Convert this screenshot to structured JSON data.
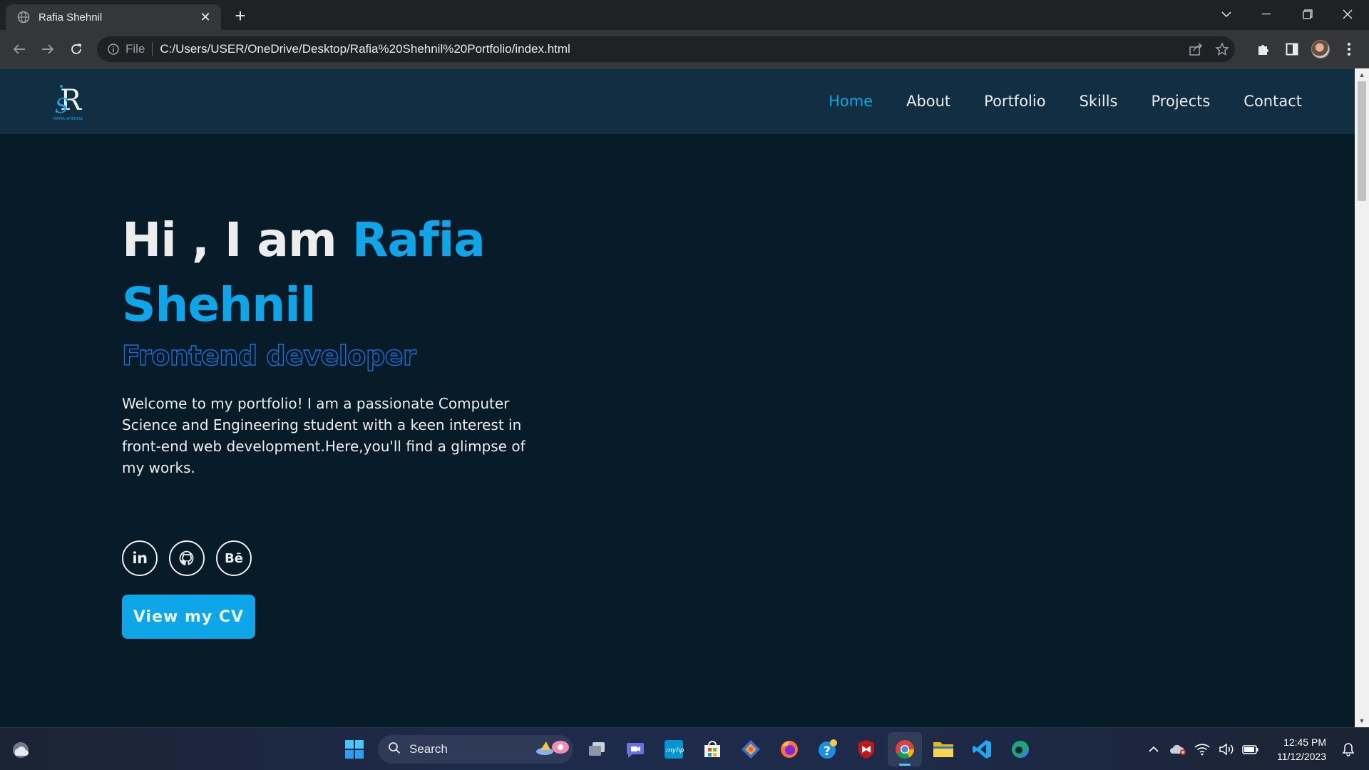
{
  "browser": {
    "tab_title": "Rafia Shehnil",
    "address_scheme": "File",
    "address_url": "C:/Users/USER/OneDrive/Desktop/Rafia%20Shehnil%20Portfolio/index.html"
  },
  "site": {
    "logo_icon": "rs-monogram-logo",
    "logo_caption": "RAFIA SHEHNIL",
    "nav": [
      {
        "label": "Home",
        "active": true
      },
      {
        "label": "About",
        "active": false
      },
      {
        "label": "Portfolio",
        "active": false
      },
      {
        "label": "Skills",
        "active": false
      },
      {
        "label": "Projects",
        "active": false
      },
      {
        "label": "Contact",
        "active": false
      }
    ],
    "hero": {
      "greeting": "Hi , I am ",
      "name_first": "Rafia",
      "name_last": "Shehnil",
      "role": "Frontend developer",
      "intro": "Welcome to my portfolio! I am a passionate Computer Science and Engineering student with a keen interest in front-end web development.Here,you'll find a glimpse of my works.",
      "socials": [
        {
          "icon": "linkedin-icon",
          "text": "in"
        },
        {
          "icon": "github-icon",
          "text": ""
        },
        {
          "icon": "behance-icon",
          "text": "Bē"
        }
      ],
      "cv_button": "View my CV"
    },
    "colors": {
      "accent": "#0ea5e9",
      "background": "#081b29",
      "header": "#112e42",
      "text": "#ededed"
    }
  },
  "taskbar": {
    "search_label": "Search",
    "time": "12:45 PM",
    "date": "11/12/2023",
    "apps": [
      "windows-start-icon",
      "search-icon",
      "task-view-icon",
      "chat-icon",
      "myhp-icon",
      "store-icon",
      "snipping-icon",
      "firefox-icon",
      "help-icon",
      "mcafee-icon",
      "chrome-icon",
      "file-explorer-icon",
      "vscode-icon",
      "edge-icon"
    ]
  }
}
